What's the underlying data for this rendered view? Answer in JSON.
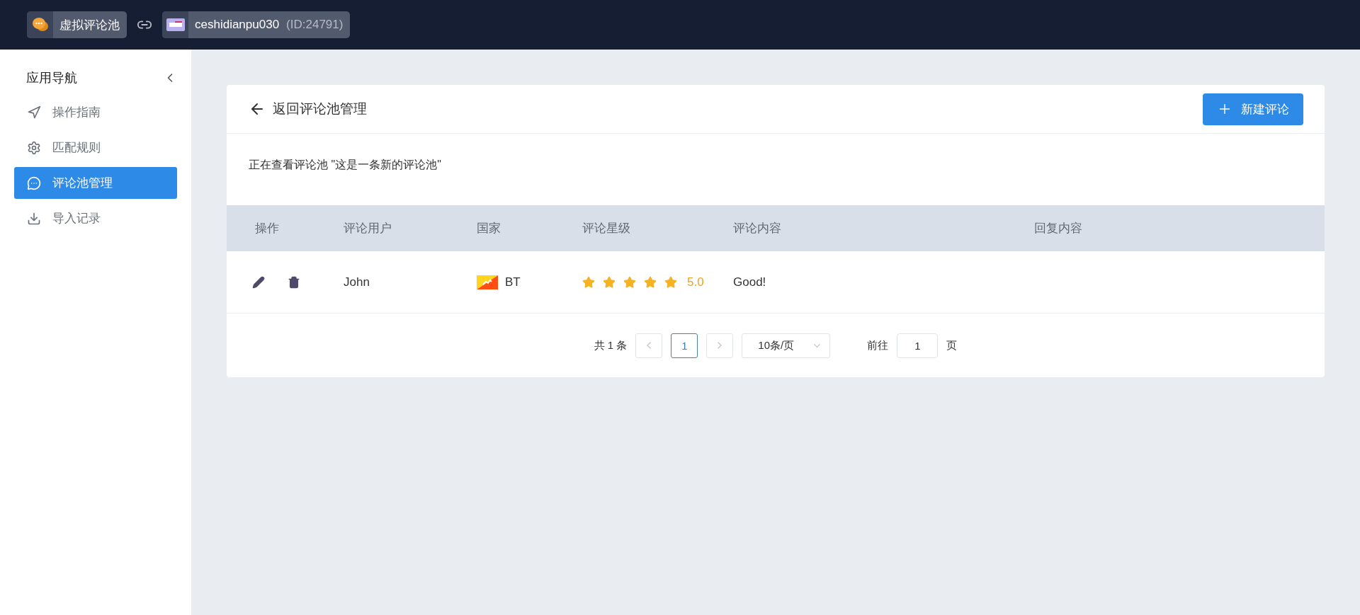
{
  "topbar": {
    "app_chip": {
      "label": "虚拟评论池"
    },
    "store_chip": {
      "label": "ceshidianpu030",
      "id": "(ID:24791)"
    }
  },
  "sidebar": {
    "title": "应用导航",
    "items": [
      {
        "label": "操作指南",
        "kind": "guide",
        "selected": false
      },
      {
        "label": "匹配规则",
        "kind": "rules",
        "selected": false
      },
      {
        "label": "评论池管理",
        "kind": "comments",
        "selected": true
      },
      {
        "label": "导入记录",
        "kind": "import",
        "selected": false
      }
    ]
  },
  "page": {
    "back_link": "返回评论池管理",
    "new_button": "新建评论",
    "description": "正在查看评论池 \"这是一条新的评论池\""
  },
  "table": {
    "columns": [
      "操作",
      "评论用户",
      "国家",
      "评论星级",
      "评论内容",
      "回复内容"
    ],
    "rows": [
      {
        "user": "John",
        "country": "BT",
        "stars": 5,
        "rating": "5.0",
        "content": "Good!"
      }
    ]
  },
  "pagination": {
    "total": "共 1 条",
    "pages": [
      {
        "label": "1",
        "selected": true
      }
    ],
    "page_size": "10条/页",
    "goto_label": "前往",
    "goto_value": "1",
    "goto_suffix": "页"
  }
}
